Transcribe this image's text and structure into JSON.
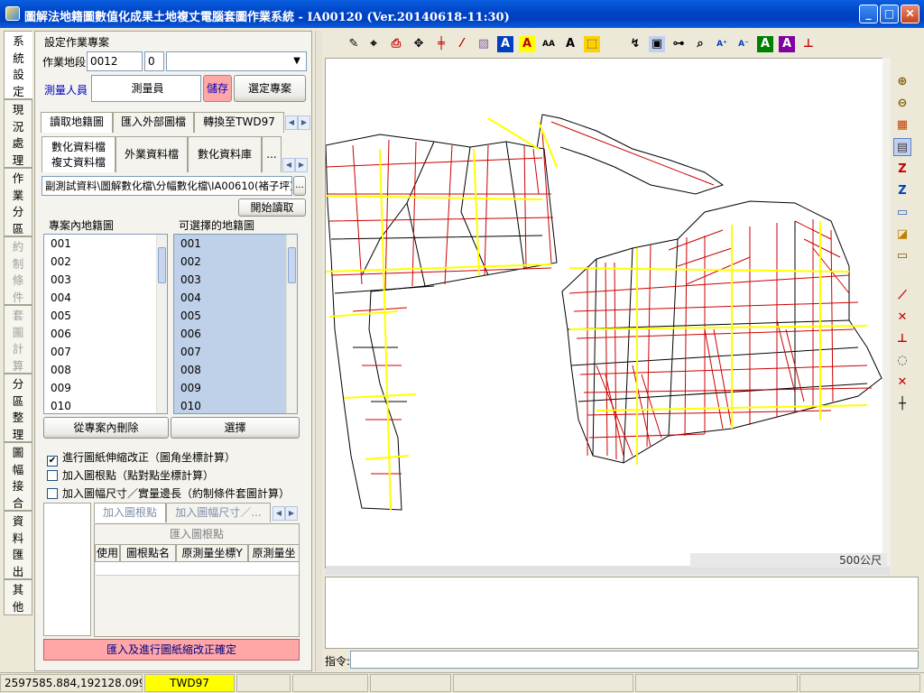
{
  "window": {
    "title": "圖解法地籍圖數值化成果土地複丈電腦套圖作業系統 - IA00120 (Ver.20140618-11:30)"
  },
  "side_tabs": [
    "系統設定",
    "現況處理",
    "作業分區",
    "約制條件",
    "套圖計算",
    "分區整理",
    "圖幅接合",
    "資料匯出",
    "其他"
  ],
  "project": {
    "group_label": "設定作業專案",
    "section_label": "作業地段",
    "section_code": "0012",
    "section_sub": "0",
    "surveyor_label": "測量人員",
    "surveyor_value": "測量員",
    "save_label": "儲存",
    "select_label": "選定專案"
  },
  "tabs1": [
    "讀取地籍圖",
    "匯入外部圖檔",
    "轉換至TWD97"
  ],
  "tabs2": [
    "數化資料檔",
    "複丈資料檔",
    "外業資料檔",
    "數化資料庫",
    "..."
  ],
  "path": {
    "value": "副測試資料\\圖解數化檔\\分幅數化檔\\IA00610(褚子坪)\\",
    "browse": "..."
  },
  "start_read_label": "開始讀取",
  "lists": {
    "project_caption": "專案內地籍圖",
    "available_caption": "可選擇的地籍圖",
    "project_items": [
      "001",
      "002",
      "003",
      "004",
      "005",
      "006",
      "007",
      "008",
      "009",
      "010"
    ],
    "available_items": [
      "001",
      "002",
      "003",
      "004",
      "005",
      "006",
      "007",
      "008",
      "009",
      "010"
    ],
    "remove_label": "從專案內刪除",
    "choose_label": "選擇"
  },
  "options": {
    "opt1": "進行圖紙伸縮改正（圖角坐標計算）",
    "opt2": "加入圖根點（點對點坐標計算）",
    "opt3": "加入圖幅尺寸／實量邊長（約制條件套圖計算）"
  },
  "subtabs": [
    "加入圖根點",
    "加入圖幅尺寸／..."
  ],
  "grid": {
    "title": "匯入圖根點",
    "cols": [
      "使用",
      "圖根點名",
      "原測量坐標Y",
      "原測量坐"
    ]
  },
  "confirm_label": "匯入及進行圖紙縮改正確定",
  "map": {
    "scale_label": "500公尺"
  },
  "command": {
    "label": "指令:"
  },
  "status": {
    "coords": "2597585.884,192128.099",
    "datum": "TWD97"
  },
  "colors": {
    "accent": "#0054E3",
    "confirm": "#FFA7A7",
    "grid_line": "#FFFF00",
    "parcel_line": "#CC0000",
    "datum_bg": "#FFFF00"
  },
  "toolbar_icons": [
    "pencil-icon",
    "node-icon",
    "stamp-icon",
    "move-icon",
    "line-cut-icon",
    "line-icon",
    "fill-icon",
    "text-a-red-icon",
    "text-a-yellow-icon",
    "text-aa-icon",
    "text-a-icon",
    "transform-icon",
    "snap-icon",
    "select-rect-icon",
    "measure-icon",
    "zoom-window-icon",
    "font-up-icon",
    "font-down-icon",
    "label-green-icon",
    "label-purple-icon",
    "anchor-icon"
  ],
  "right_icons": [
    "zoom-in-icon",
    "zoom-out-icon",
    "grid-icon",
    "layer-icon",
    "z-red-icon",
    "z-blue-icon",
    "save-icon",
    "frame-icon",
    "save-disk-icon",
    "line-draw-icon",
    "cross-icon",
    "perpendicular-icon",
    "circle-icon",
    "delete-icon",
    "plus-icon"
  ]
}
